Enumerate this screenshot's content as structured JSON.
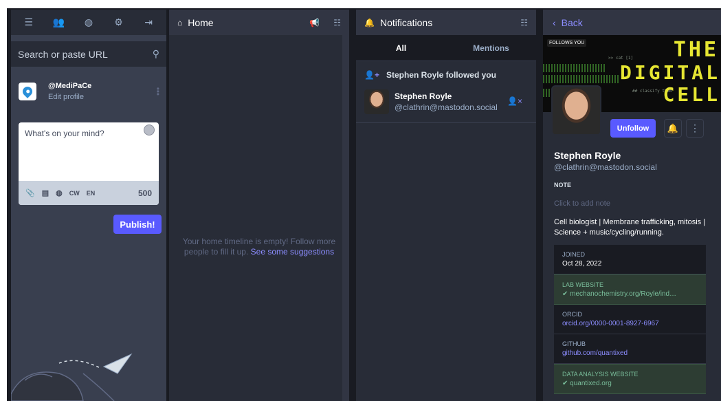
{
  "nav": {
    "icons": [
      "menu-icon",
      "people-icon",
      "globe-icon",
      "gear-icon",
      "logout-icon"
    ]
  },
  "search": {
    "placeholder": "Search or paste URL"
  },
  "me": {
    "handle": "@MediPaCe",
    "edit_label": "Edit profile"
  },
  "compose": {
    "placeholder": "What's on your mind?",
    "cw_label": "CW",
    "lang_label": "EN",
    "char_count": "500",
    "publish_label": "Publish!"
  },
  "home": {
    "title": "Home",
    "empty_text": "Your home timeline is empty! Follow more people to fill it up.",
    "suggestions_link": "See some suggestions"
  },
  "notifications": {
    "title": "Notifications",
    "tab_all": "All",
    "tab_mentions": "Mentions",
    "follow_text": "Stephen Royle followed you",
    "account": {
      "name": "Stephen Royle",
      "handle": "@clathrin@mastodon.social"
    }
  },
  "profile": {
    "back_label": "Back",
    "follows_you_badge": "FOLLOWS YOU",
    "banner_text": [
      "THE",
      "DIGITAL",
      "CELL"
    ],
    "unfollow_label": "Unfollow",
    "display_name": "Stephen Royle",
    "handle": "@clathrin@mastodon.social",
    "note_label": "NOTE",
    "note_placeholder": "Click to add note",
    "bio": "Cell biologist | Membrane trafficking, mitosis | Science + music/cycling/running.",
    "fields": [
      {
        "key": "JOINED",
        "value": "Oct 28, 2022",
        "verified": false,
        "link": false
      },
      {
        "key": "LAB WEBSITE",
        "value": "✔ mechanochemistry.org/Royle/ind…",
        "verified": true,
        "link": true
      },
      {
        "key": "ORCID",
        "value": "orcid.org/0000-0001-8927-6967",
        "verified": false,
        "link": true
      },
      {
        "key": "GITHUB",
        "value": "github.com/quantixed",
        "verified": false,
        "link": true
      },
      {
        "key": "DATA ANALYSIS WEBSITE",
        "value": "✔ quantixed.org",
        "verified": true,
        "link": true
      }
    ]
  },
  "colors": {
    "accent": "#595aff",
    "link": "#8c8dff",
    "verified": "#79bd9a",
    "bg": "#282c37"
  }
}
